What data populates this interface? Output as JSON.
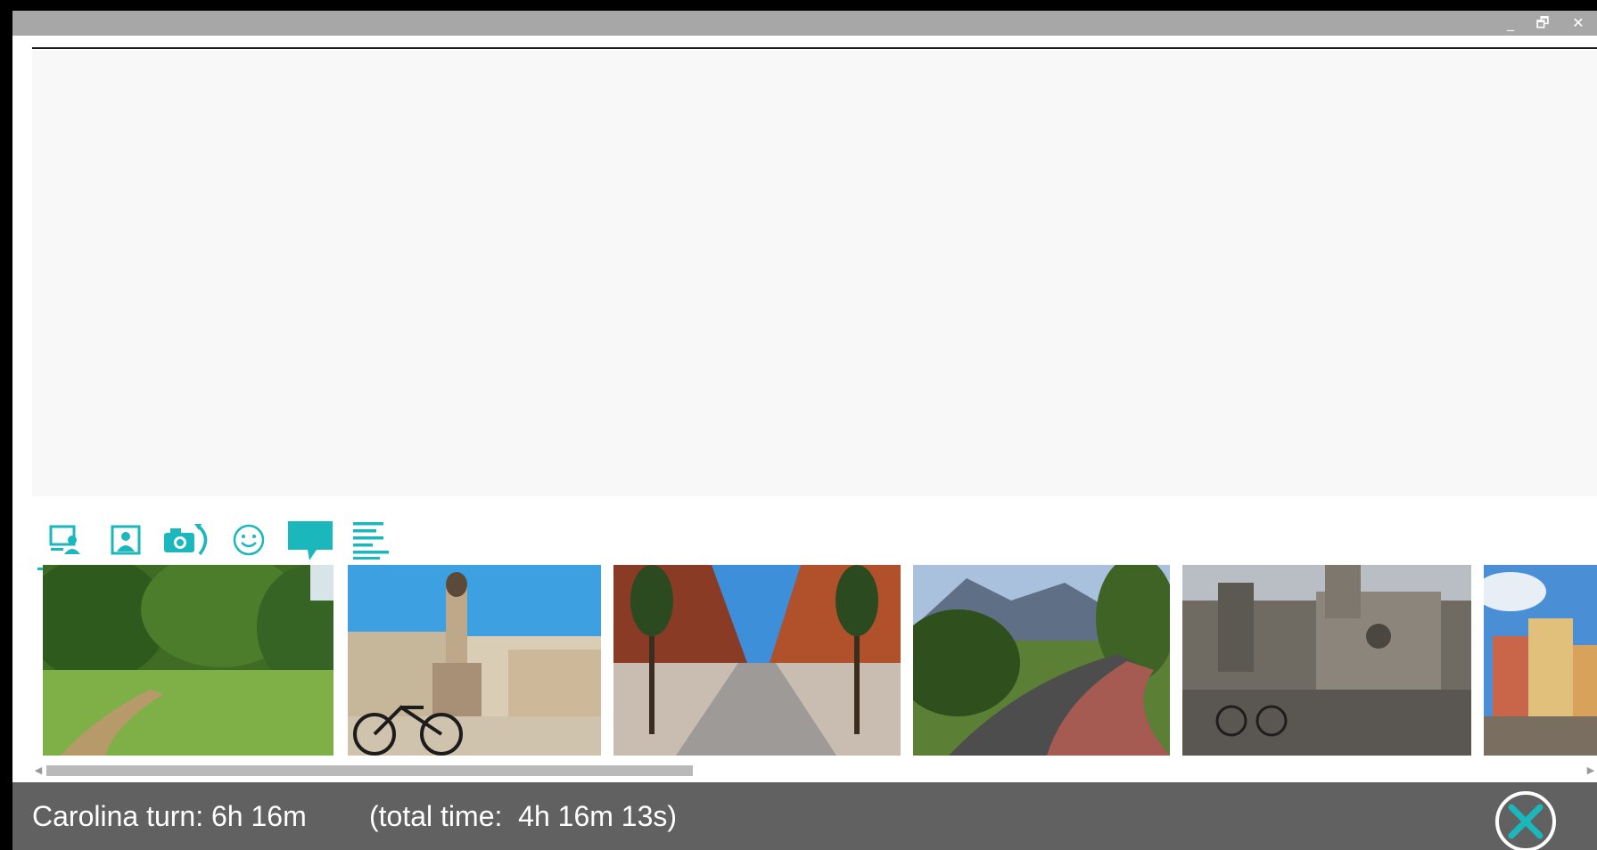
{
  "window": {
    "controls": {
      "minimize": "_",
      "maximize": "🗗",
      "close": "✕"
    }
  },
  "toolbar": {
    "tools": [
      {
        "icon": "screen-person-icon",
        "active": true
      },
      {
        "icon": "picture-portrait-icon",
        "active": false
      },
      {
        "icon": "camera-rotate-icon",
        "active": false
      },
      {
        "icon": "smiley-icon",
        "active": false
      },
      {
        "icon": "speech-bubble-icon",
        "active": false
      },
      {
        "icon": "text-lines-icon",
        "active": false
      }
    ]
  },
  "thumbnails": [
    {
      "scene": "park-lawn"
    },
    {
      "scene": "fountain-square-bicycle"
    },
    {
      "scene": "modern-street"
    },
    {
      "scene": "mountain-path"
    },
    {
      "scene": "cathedral-square"
    },
    {
      "scene": "colorful-houses"
    }
  ],
  "scrollbar": {
    "left_arrow": "◀",
    "right_arrow": "▶",
    "position_fraction": 0.0,
    "visible_fraction": 0.42
  },
  "status": {
    "turn_text": "Carolina turn: 6h 16m",
    "total_text": "(total time:  4h 16m 13s)"
  },
  "colors": {
    "accent": "#1ab7bd",
    "status_bg": "#616161",
    "titlebar_bg": "#a7a7a7"
  }
}
